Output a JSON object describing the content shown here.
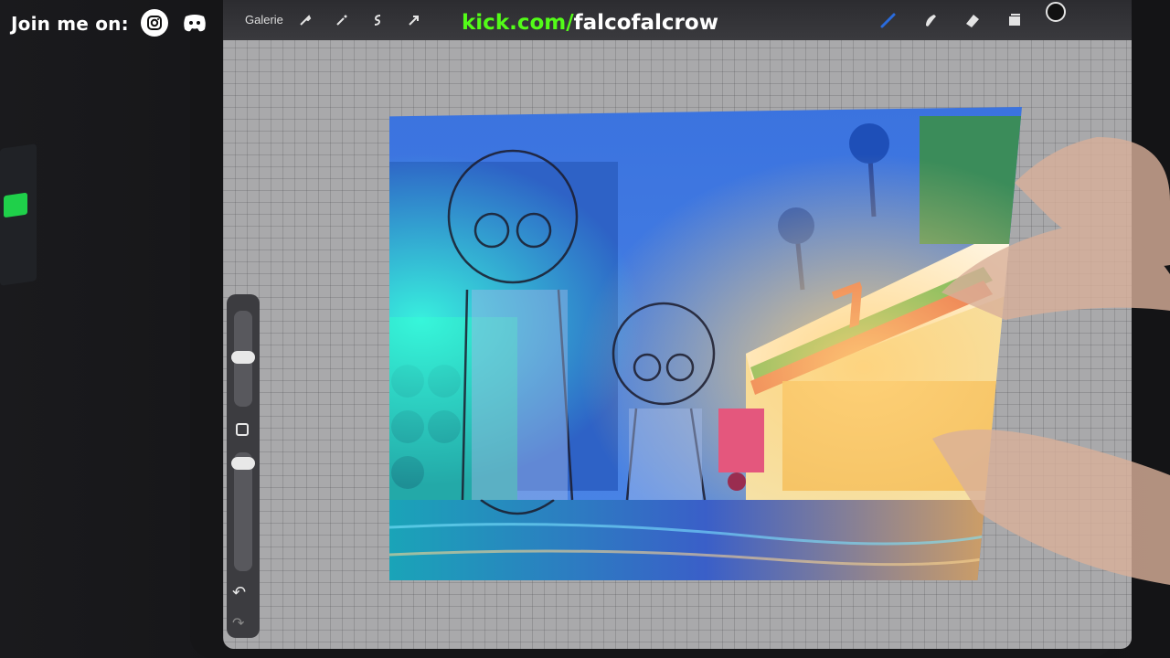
{
  "overlay": {
    "join_text": "Join me on:",
    "kick_prefix": "kick.com/",
    "kick_handle": "falcofalcrow",
    "social_icons": [
      "instagram-icon",
      "discord-icon"
    ],
    "accent_color": "#53fc18"
  },
  "toolbar": {
    "gallery_label": "Galerie",
    "left_tools": [
      "wrench-icon",
      "magic-wand-icon",
      "selection-icon",
      "transform-arrow-icon"
    ],
    "right_tools": [
      "brush-icon",
      "smudge-icon",
      "eraser-icon",
      "layers-icon",
      "color-picker-icon"
    ],
    "active_tool": "brush-icon",
    "active_color": "#2a6bdc"
  },
  "sidebar": {
    "tools": [
      "brush-size-slider",
      "modify-button",
      "opacity-slider",
      "undo-icon",
      "redo-icon"
    ]
  }
}
